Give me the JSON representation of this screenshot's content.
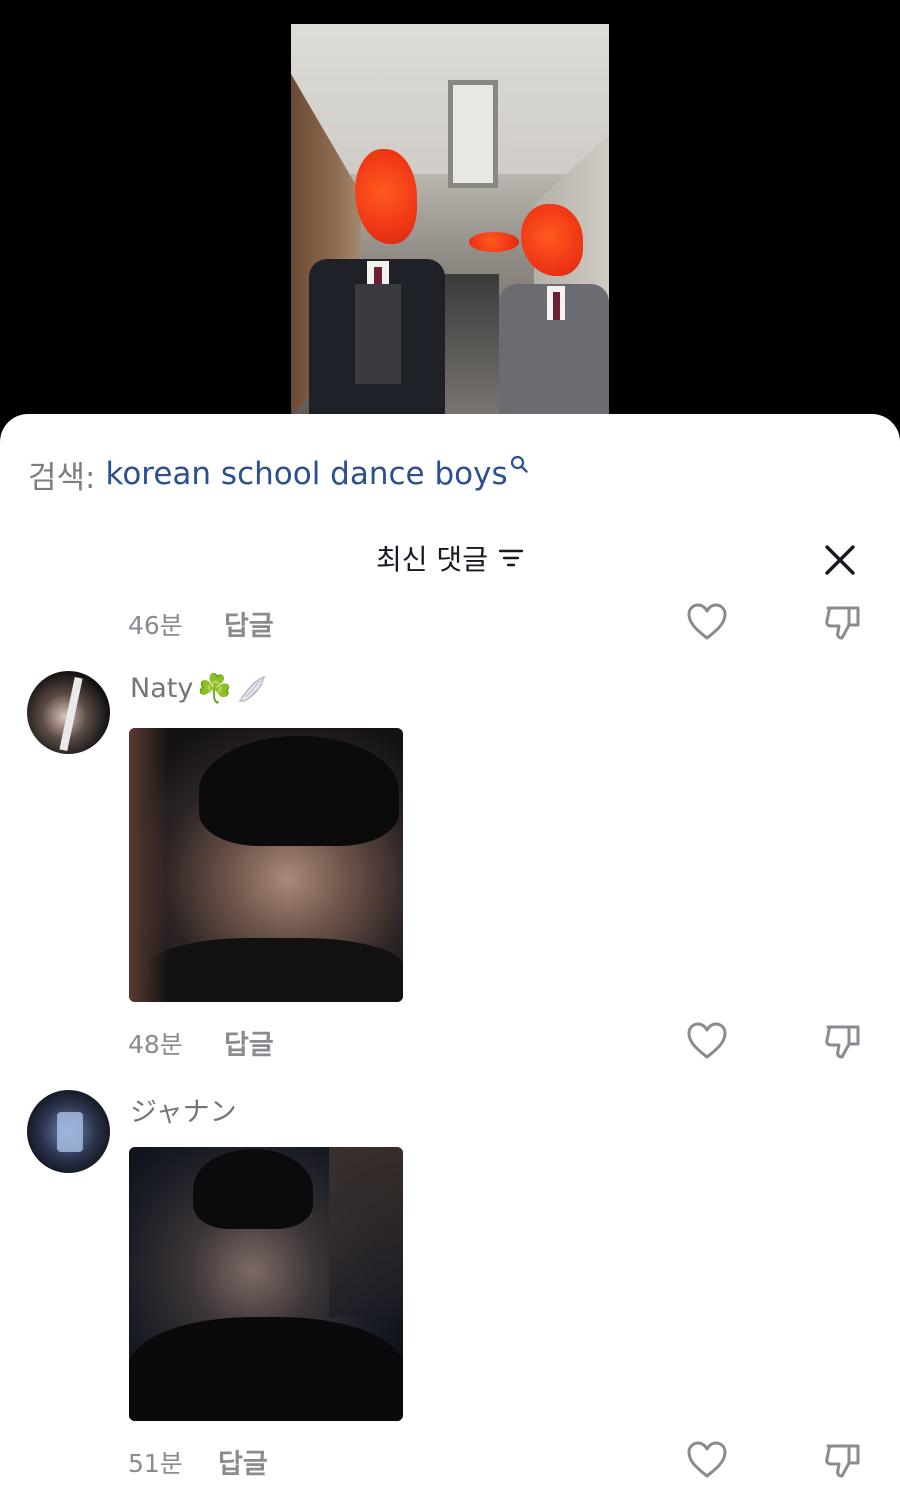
{
  "search": {
    "prefix": "검색:",
    "query": "korean school dance boys"
  },
  "header": {
    "title": "최신 댓글"
  },
  "comments": [
    {
      "time": "46분",
      "reply_label": "답글"
    },
    {
      "username": "Naty",
      "emoji": "☘️",
      "time": "48분",
      "reply_label": "답글"
    },
    {
      "username": "ジャナン",
      "time": "51분",
      "reply_label": "답글"
    }
  ],
  "colors": {
    "search_link": "#2c4f92",
    "meta_text": "#8a8b91",
    "title_text": "#161823"
  }
}
